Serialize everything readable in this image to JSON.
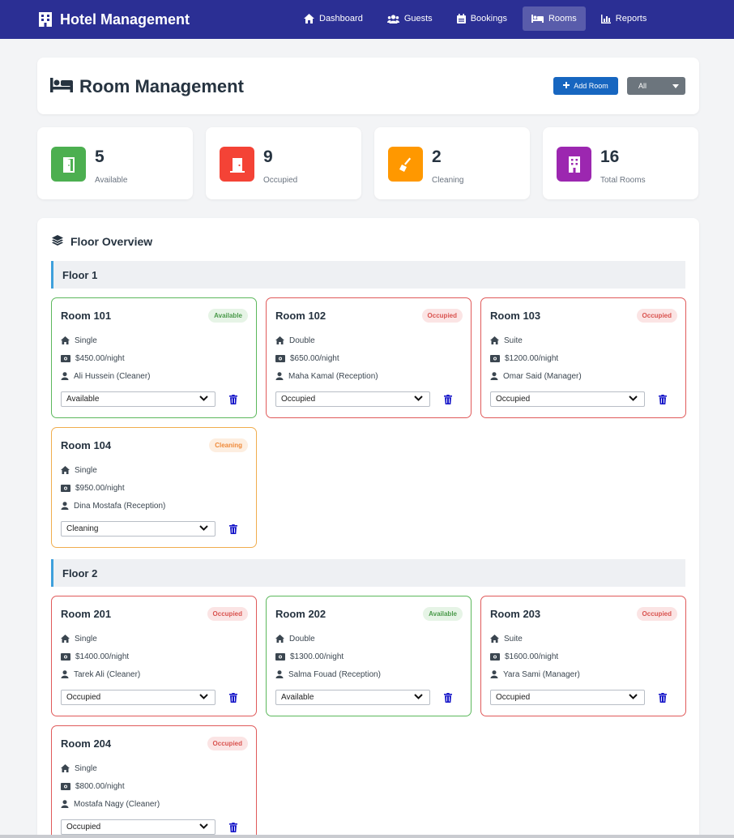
{
  "app": {
    "title": "Hotel Management"
  },
  "nav": [
    {
      "label": "Dashboard",
      "icon": "home-icon",
      "active": false
    },
    {
      "label": "Guests",
      "icon": "users-icon",
      "active": false
    },
    {
      "label": "Bookings",
      "icon": "calendar-icon",
      "active": false
    },
    {
      "label": "Rooms",
      "icon": "bed-icon",
      "active": true
    },
    {
      "label": "Reports",
      "icon": "chart-icon",
      "active": false
    }
  ],
  "page": {
    "title": "Room Management",
    "add_button": "Add Room",
    "filter": {
      "selected": "All"
    }
  },
  "stats": [
    {
      "value": "5",
      "label": "Available",
      "color": "#4caf50",
      "icon": "door-open-icon"
    },
    {
      "value": "9",
      "label": "Occupied",
      "color": "#f44336",
      "icon": "door-closed-icon"
    },
    {
      "value": "2",
      "label": "Cleaning",
      "color": "#ff9800",
      "icon": "broom-icon"
    },
    {
      "value": "16",
      "label": "Total Rooms",
      "color": "#9c27b0",
      "icon": "building-icon"
    }
  ],
  "overview": {
    "title": "Floor Overview",
    "floors": [
      {
        "title": "Floor 1",
        "rooms": [
          {
            "name": "Room 101",
            "status": "Available",
            "type": "Single",
            "price": "$450.00/night",
            "staff": "Ali Hussein (Cleaner)",
            "select": "Available"
          },
          {
            "name": "Room 102",
            "status": "Occupied",
            "type": "Double",
            "price": "$650.00/night",
            "staff": "Maha Kamal (Reception)",
            "select": "Occupied"
          },
          {
            "name": "Room 103",
            "status": "Occupied",
            "type": "Suite",
            "price": "$1200.00/night",
            "staff": "Omar Said (Manager)",
            "select": "Occupied"
          },
          {
            "name": "Room 104",
            "status": "Cleaning",
            "type": "Single",
            "price": "$950.00/night",
            "staff": "Dina Mostafa (Reception)",
            "select": "Cleaning"
          }
        ]
      },
      {
        "title": "Floor 2",
        "rooms": [
          {
            "name": "Room 201",
            "status": "Occupied",
            "type": "Single",
            "price": "$1400.00/night",
            "staff": "Tarek Ali (Cleaner)",
            "select": "Occupied"
          },
          {
            "name": "Room 202",
            "status": "Available",
            "type": "Double",
            "price": "$1300.00/night",
            "staff": "Salma Fouad (Reception)",
            "select": "Available"
          },
          {
            "name": "Room 203",
            "status": "Occupied",
            "type": "Suite",
            "price": "$1600.00/night",
            "staff": "Yara Sami (Manager)",
            "select": "Occupied"
          },
          {
            "name": "Room 204",
            "status": "Occupied",
            "type": "Single",
            "price": "$800.00/night",
            "staff": "Mostafa Nagy (Cleaner)",
            "select": "Occupied"
          }
        ]
      }
    ]
  }
}
